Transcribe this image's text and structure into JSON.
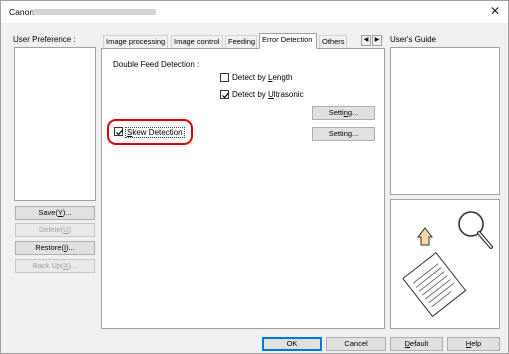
{
  "window": {
    "title": "Canon",
    "close_glyph": "✕"
  },
  "left": {
    "label": "User Preference :",
    "buttons": {
      "save": "Save(Y)...",
      "delete": "Delete(U)",
      "restore": "Restore(I)...",
      "backup": "Back Up(X)..."
    }
  },
  "tabs": [
    {
      "label": "Image processing"
    },
    {
      "label": "Image control"
    },
    {
      "label": "Feeding"
    },
    {
      "label": "Error Detection"
    },
    {
      "label": "Others"
    }
  ],
  "tab_scroll": {
    "left": "◀",
    "right": "▶"
  },
  "error_detection": {
    "double_feed_label": "Double Feed Detection :",
    "detect_by_length": {
      "label": "Detect by Length",
      "checked": false
    },
    "detect_by_ultrasonic": {
      "label": "Detect by Ultrasonic",
      "checked": true
    },
    "setting_button_1": "Setting...",
    "skew_detection": {
      "label": "Skew Detection",
      "checked": true
    },
    "setting_button_2": "Setting..."
  },
  "right": {
    "label": "User's Guide"
  },
  "footer": {
    "ok": "OK",
    "cancel": "Cancel",
    "default": "Default",
    "help": "Help"
  },
  "colors": {
    "highlight": "#e30000",
    "focus": "#0078d7"
  }
}
